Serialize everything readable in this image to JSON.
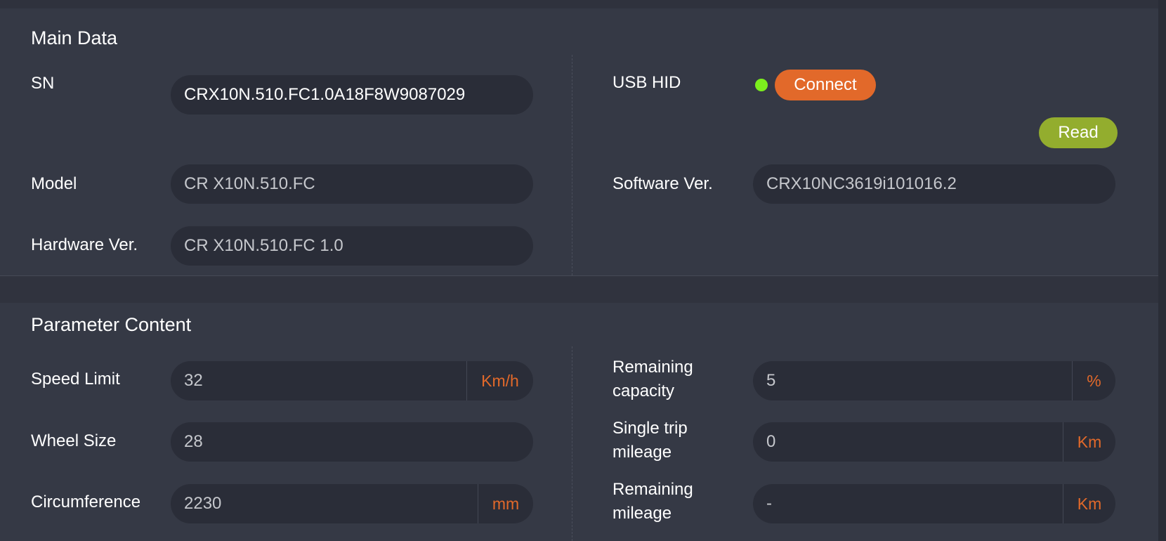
{
  "main": {
    "title": "Main Data",
    "sn": {
      "label": "SN",
      "value": "CRX10N.510.FC1.0A18F8W9087029"
    },
    "model": {
      "label": "Model",
      "value": "CR X10N.510.FC"
    },
    "hardware": {
      "label": "Hardware Ver.",
      "value": "CR X10N.510.FC 1.0"
    },
    "usb": {
      "label": "USB HID",
      "connect_label": "Connect",
      "status_color": "#7cef1d"
    },
    "read_label": "Read",
    "software": {
      "label": "Software Ver.",
      "value": "CRX10NC3619i101016.2"
    }
  },
  "params": {
    "title": "Parameter Content",
    "speed_limit": {
      "label": "Speed Limit",
      "value": "32",
      "unit": "Km/h"
    },
    "wheel_size": {
      "label": "Wheel Size",
      "value": "28"
    },
    "circumference": {
      "label": "Circumference",
      "value": "2230",
      "unit": "mm"
    },
    "remaining_capacity": {
      "label_line1": "Remaining",
      "label_line2": "capacity",
      "value": "5",
      "unit": "%"
    },
    "single_trip": {
      "label_line1": "Single trip",
      "label_line2": "mileage",
      "value": "0",
      "unit": "Km"
    },
    "remaining_mileage": {
      "label_line1": "Remaining",
      "label_line2": "mileage",
      "value": "-",
      "unit": "Km"
    }
  },
  "colors": {
    "accent_orange": "#e2692a",
    "accent_green": "#93ad2e",
    "status_green": "#7cef1d",
    "panel_bg": "#353945",
    "field_bg": "#2a2d38"
  }
}
